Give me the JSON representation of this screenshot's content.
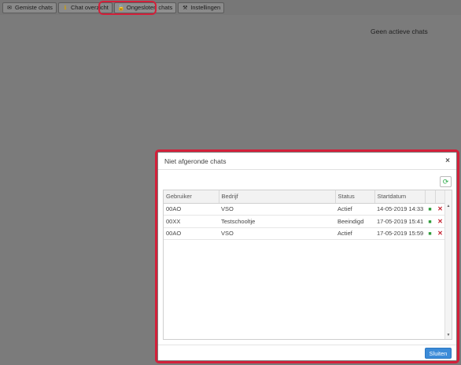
{
  "toolbar": {
    "items": [
      {
        "label": "Gemiste chats",
        "icon": "envelope-icon"
      },
      {
        "label": "Chat overzicht",
        "icon": "info-icon"
      },
      {
        "label": "Ongesloten chats",
        "icon": "lock-open-icon"
      },
      {
        "label": "Instellingen",
        "icon": "wrench-icon"
      }
    ]
  },
  "main": {
    "empty_text": "Geen actieve chats"
  },
  "modal": {
    "title": "Niet afgeronde chats",
    "close_symbol": "×",
    "columns": [
      "Gebruiker",
      "Bedrijf",
      "Status",
      "Startdatum"
    ],
    "rows": [
      {
        "user": "00AO",
        "company": "VSO",
        "status": "Actief",
        "start": "14-05-2019 14:33"
      },
      {
        "user": "00XX",
        "company": "Testschooltje",
        "status": "Beeindigd",
        "start": "17-05-2019 15:41"
      },
      {
        "user": "00AO",
        "company": "VSO",
        "status": "Actief",
        "start": "17-05-2019 15:59"
      }
    ],
    "close_button": "Sluiten"
  },
  "colors": {
    "highlight": "#d3203a",
    "primary": "#3b8bd8",
    "save": "#2e9b3a",
    "delete": "#c41f2e"
  }
}
